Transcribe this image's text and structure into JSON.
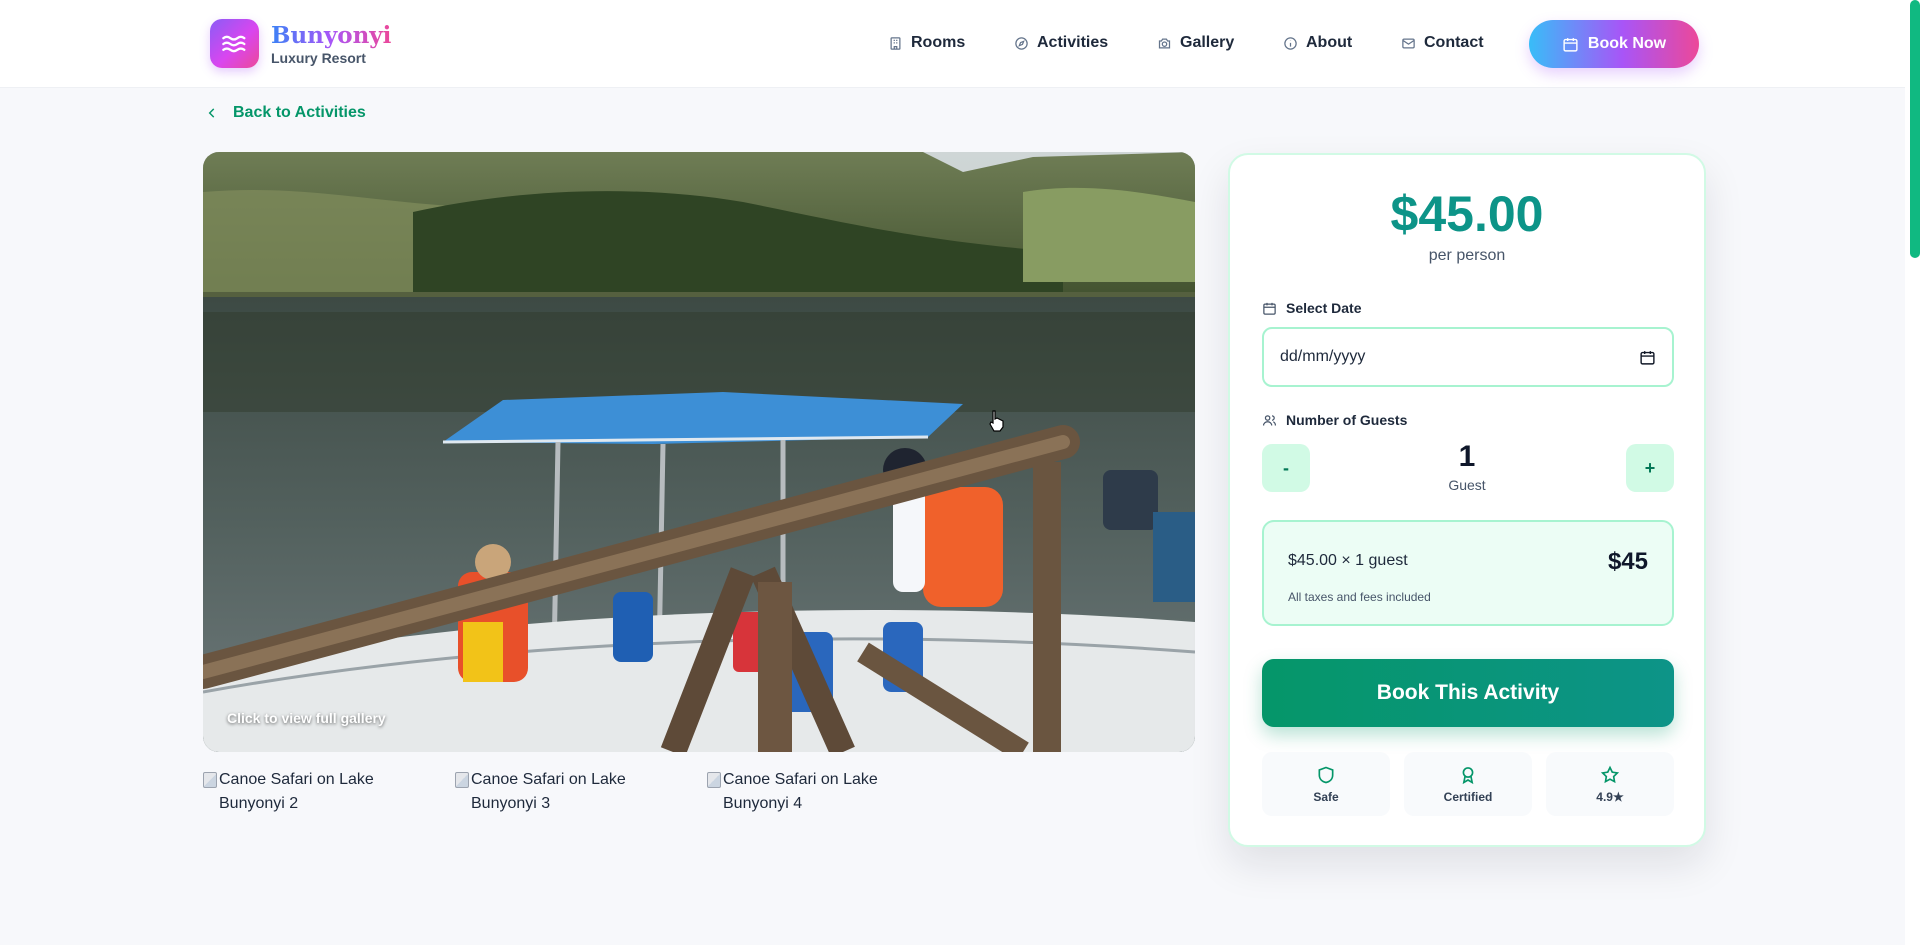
{
  "brand": {
    "title": "Bunyonyi",
    "subtitle": "Luxury Resort",
    "logo_icon": "waves-icon"
  },
  "nav": [
    {
      "label": "Rooms",
      "icon": "building-icon"
    },
    {
      "label": "Activities",
      "icon": "compass-icon"
    },
    {
      "label": "Gallery",
      "icon": "camera-icon"
    },
    {
      "label": "About",
      "icon": "info-icon"
    },
    {
      "label": "Contact",
      "icon": "mail-icon"
    }
  ],
  "book_now": {
    "label": "Book Now",
    "icon": "calendar-icon"
  },
  "back": {
    "label": "Back to Activities"
  },
  "gallery": {
    "hint": "Click to view full gallery",
    "thumbnails": [
      {
        "alt": "Canoe Safari on Lake Bunyonyi 2"
      },
      {
        "alt": "Canoe Safari on Lake Bunyonyi 3"
      },
      {
        "alt": "Canoe Safari on Lake Bunyonyi 4"
      }
    ]
  },
  "booking": {
    "price": "$45.00",
    "per": "per person",
    "date_label": "Select Date",
    "date_placeholder": "dd/mm/yyyy",
    "guests_label": "Number of Guests",
    "minus": "-",
    "plus": "+",
    "guest_count": "1",
    "guest_word": "Guest",
    "summary_line": "$45.00 × 1 guest",
    "summary_total": "$45",
    "summary_note": "All taxes and fees included",
    "book_label": "Book This Activity",
    "badges": [
      {
        "label": "Safe",
        "icon": "shield-icon"
      },
      {
        "label": "Certified",
        "icon": "award-icon"
      },
      {
        "label": "4.9★",
        "icon": "star-icon"
      }
    ]
  },
  "colors": {
    "accent": "#059669",
    "teal": "#0d9488",
    "brand_gradient": [
      "#38bdf8",
      "#a855f7",
      "#ec4899"
    ]
  }
}
